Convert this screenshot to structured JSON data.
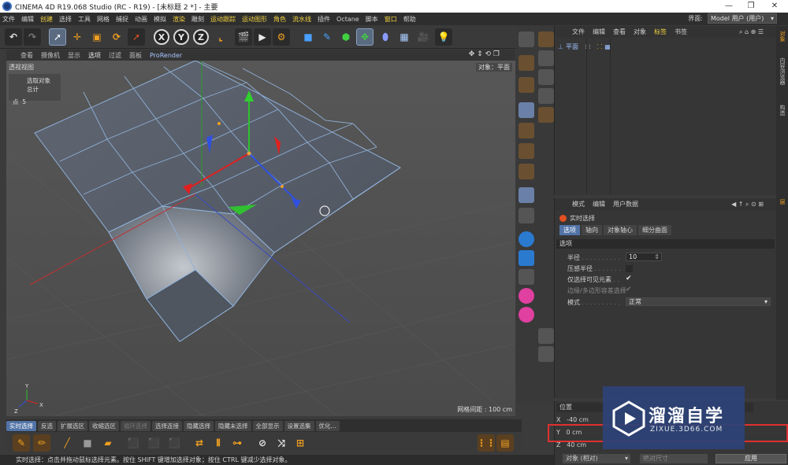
{
  "window": {
    "title": "CINEMA 4D R19.068 Studio (RC - R19) - [未标题 2 *] - 主要",
    "controls": [
      "—",
      "❐",
      "✕"
    ]
  },
  "menubar": {
    "items": [
      "文件",
      "编辑",
      "创建",
      "选择",
      "工具",
      "网格",
      "捕捉",
      "动画",
      "模拟",
      "渲染",
      "雕刻",
      "运动跟踪",
      "运动图形",
      "角色",
      "流水线",
      "插件",
      "Octane",
      "脚本",
      "窗口",
      "帮助"
    ],
    "layout_label": "界面:",
    "layout_value": "Model 用户 (用户)"
  },
  "toolbar": {
    "axis_x": "X",
    "axis_y": "Y",
    "axis_z": "Z"
  },
  "viewport": {
    "menu": [
      "查看",
      "摄像机",
      "显示",
      "选项",
      "过滤",
      "面板",
      "ProRender"
    ],
    "camera": "透视视图",
    "hud_line1": "选取对象 总计",
    "hud_line2_label": "点",
    "hud_line2_value": "5",
    "object_label": "对象：平面",
    "grid_spacing": "网格间距 : 100 cm"
  },
  "selection_tabs": [
    "实时选择",
    "反选",
    "扩展选区",
    "收缩选区",
    "循环选择",
    "选择连接",
    "隐藏选择",
    "隐藏未选择",
    "全部显示",
    "设置选集",
    "优化..."
  ],
  "status": "实时选择：点击并拖动鼠标选择元素。按住 SHIFT 键增加选择对象；按住 CTRL 键减少选择对象。",
  "object_manager": {
    "menu": [
      "文件",
      "编辑",
      "查看",
      "对象",
      "标签",
      "书签"
    ],
    "object_name": "平面"
  },
  "attributes": {
    "menu": [
      "模式",
      "编辑",
      "用户数据"
    ],
    "tool_name": "实时选择",
    "tabs": [
      "选项",
      "轴向",
      "对象轴心",
      "细分曲面"
    ],
    "section": "选项",
    "radius_label": "半径",
    "radius_value": "10",
    "pressure_label": "压感半径",
    "visible_only_label": "仅选择可见元素",
    "edge_label": "边缘/多边形容差选择",
    "mode_label": "模式",
    "mode_value": "正常"
  },
  "coordinates": {
    "header": "位置",
    "x_label": "X",
    "x_value": "-40 cm",
    "y_label": "Y",
    "y_value": "0 cm",
    "z_label": "Z",
    "z_value": "40 cm",
    "space_select": "对象 (相对)",
    "size_select": "绝对尺寸",
    "apply_label": "应用"
  },
  "right_tabs": [
    "对象",
    "内容浏览器",
    "构造",
    "层"
  ],
  "watermark": {
    "title": "溜溜自学",
    "url": "ZIXUE.3D66.COM"
  },
  "colors": {
    "accent": "#5173a6",
    "highlight_box": "#e03030",
    "axis_x": "#e02020",
    "axis_y": "#30c030",
    "axis_z": "#3050e0"
  }
}
